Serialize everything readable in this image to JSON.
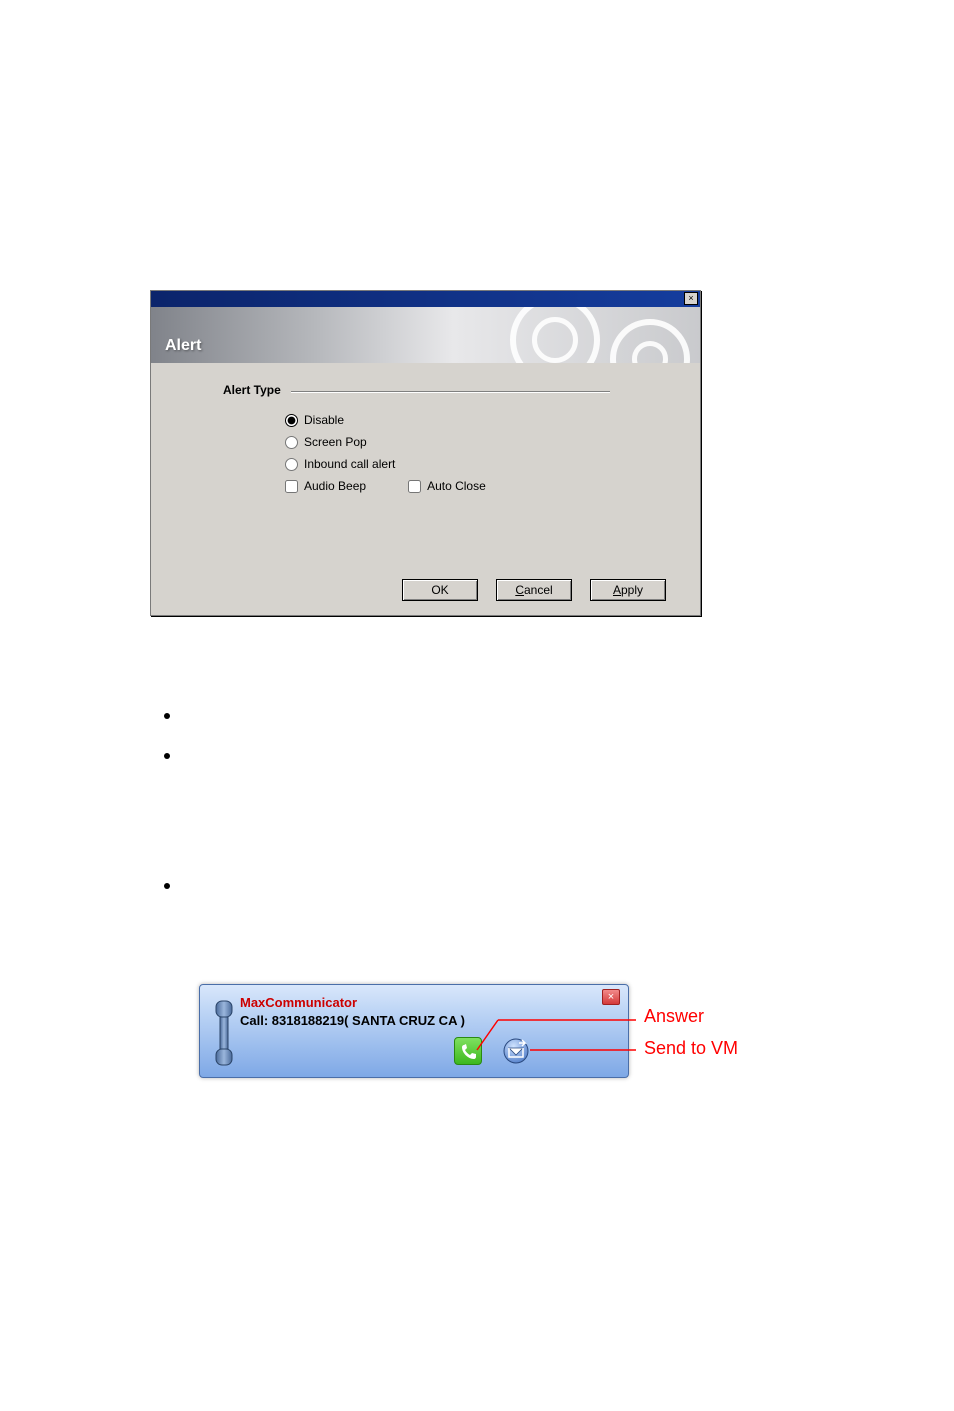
{
  "dialog": {
    "title": "Alert",
    "close_x": "×",
    "group_label": "Alert Type",
    "radios": {
      "disable": "Disable",
      "screen_pop": "Screen Pop",
      "inbound_call_alert": "Inbound call alert"
    },
    "checkboxes": {
      "audio_beep": "Audio Beep",
      "auto_close": "Auto Close"
    },
    "radio_selected": "disable",
    "checkbox_state": {
      "audio_beep": false,
      "auto_close": false
    },
    "buttons": {
      "ok": "OK",
      "cancel": "Cancel",
      "apply": "Apply"
    }
  },
  "popup": {
    "app_name": "MaxCommunicator",
    "call_line": "Call: 8318188219( SANTA CRUZ  CA )",
    "close_x": "×"
  },
  "callouts": {
    "answer": "Answer",
    "send_to_vm": "Send to VM"
  }
}
